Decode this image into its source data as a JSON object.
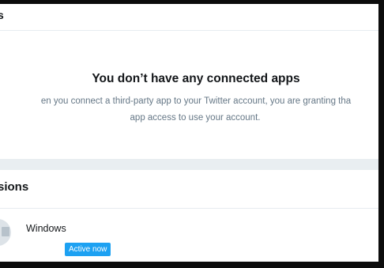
{
  "header": {
    "title": "s"
  },
  "empty_state": {
    "title": "You don’t have any connected apps",
    "description_line1": "en you connect a third-party app to your Twitter account, you are granting tha",
    "description_line2": "app access to use your account."
  },
  "sessions": {
    "title": "sions",
    "items": [
      {
        "name": "Windows",
        "badge": "Active now",
        "icon": "device-icon"
      }
    ]
  },
  "colors": {
    "accent": "#1da1f2",
    "text_primary": "#14171a",
    "text_secondary": "#657786",
    "divider": "#e9eef1",
    "frame": "#0c0c0c"
  }
}
